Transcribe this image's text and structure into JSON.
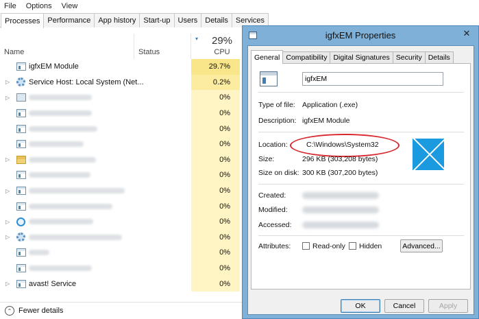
{
  "task_manager": {
    "menu": [
      "File",
      "Options",
      "View"
    ],
    "tabs": [
      "Processes",
      "Performance",
      "App history",
      "Start-up",
      "Users",
      "Details",
      "Services"
    ],
    "active_tab": "Processes",
    "columns": {
      "name": "Name",
      "status": "Status",
      "cpu_percent": "29%",
      "cpu": "CPU"
    },
    "rows": [
      {
        "name": "igfxEM Module",
        "cpu": "29.7%",
        "icon": "window-icon",
        "expandable": false
      },
      {
        "name": "Service Host: Local System (Net...",
        "cpu": "0.2%",
        "icon": "gear-icon",
        "expandable": true
      },
      {
        "name": "",
        "cpu": "0%",
        "icon": "network-icon",
        "expandable": true
      },
      {
        "name": "",
        "cpu": "0%",
        "icon": "window-icon",
        "expandable": false
      },
      {
        "name": "",
        "cpu": "0%",
        "icon": "window-icon",
        "expandable": false
      },
      {
        "name": "",
        "cpu": "0%",
        "icon": "window-icon",
        "expandable": false
      },
      {
        "name": "",
        "cpu": "0%",
        "icon": "folder-icon",
        "expandable": true
      },
      {
        "name": "",
        "cpu": "0%",
        "icon": "window-icon",
        "expandable": false
      },
      {
        "name": "",
        "cpu": "0%",
        "icon": "window-icon",
        "expandable": true
      },
      {
        "name": "",
        "cpu": "0%",
        "icon": "window-icon",
        "expandable": false
      },
      {
        "name": "",
        "cpu": "0%",
        "icon": "ie-icon",
        "expandable": true
      },
      {
        "name": "",
        "cpu": "0%",
        "icon": "gear-icon",
        "expandable": true
      },
      {
        "name": "",
        "cpu": "0%",
        "icon": "window-icon",
        "expandable": false
      },
      {
        "name": "",
        "cpu": "0%",
        "icon": "window-icon",
        "expandable": false
      },
      {
        "name": "avast! Service",
        "cpu": "0%",
        "icon": "window-icon",
        "expandable": true
      }
    ],
    "footer_label": "Fewer details"
  },
  "dialog": {
    "title": "igfxEM Properties",
    "tabs": [
      "General",
      "Compatibility",
      "Digital Signatures",
      "Security",
      "Details"
    ],
    "active_tab": "General",
    "file_name": "igfxEM",
    "fields": {
      "type_label": "Type of file:",
      "type_value": "Application (.exe)",
      "description_label": "Description:",
      "description_value": "igfxEM Module",
      "location_label": "Location:",
      "location_value": "C:\\Windows\\System32",
      "size_label": "Size:",
      "size_value": "296 KB (303,208 bytes)",
      "size_on_disk_label": "Size on disk:",
      "size_on_disk_value": "300 KB (307,200 bytes)",
      "created_label": "Created:",
      "modified_label": "Modified:",
      "accessed_label": "Accessed:",
      "attributes_label": "Attributes:",
      "readonly_label": "Read-only",
      "hidden_label": "Hidden",
      "advanced_label": "Advanced..."
    },
    "buttons": {
      "ok": "OK",
      "cancel": "Cancel",
      "apply": "Apply"
    },
    "close_glyph": "✕"
  },
  "colors": {
    "cpu_highlight": "#f9e68a",
    "cpu_cell": "#fff4c4",
    "dialog_border": "#7fb0d8",
    "callout": "#d9272e",
    "windows_logo": "#1b9ae0"
  }
}
